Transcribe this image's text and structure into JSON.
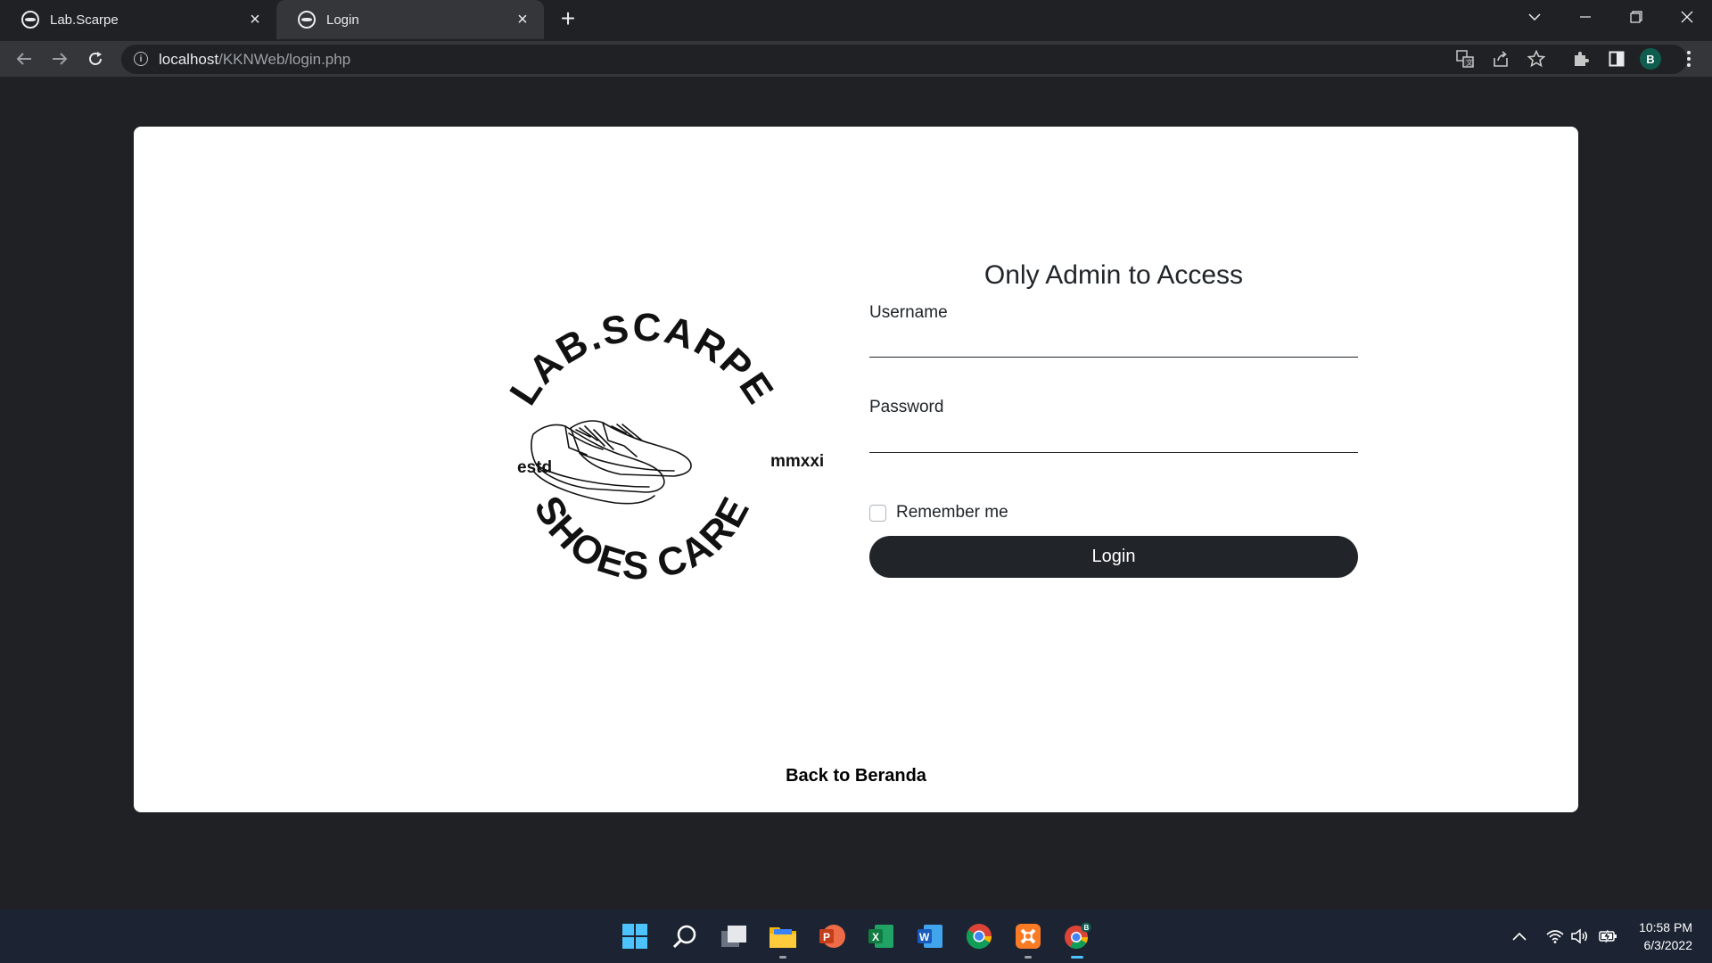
{
  "browser": {
    "tabs": [
      {
        "title": "Lab.Scarpe",
        "active": false
      },
      {
        "title": "Login",
        "active": true
      }
    ],
    "url_host": "localhost",
    "url_path": "/KKNWeb/login.php",
    "profile_initial": "B"
  },
  "logo": {
    "top_text": "LAB.SCARPE",
    "bottom_text": "SHOES CARE",
    "left_text": "estd",
    "right_text": "mmxxi"
  },
  "login": {
    "title": "Only Admin to Access",
    "username_label": "Username",
    "username_value": "",
    "password_label": "Password",
    "password_value": "",
    "remember_label": "Remember me",
    "remember_checked": false,
    "submit_label": "Login"
  },
  "footer": {
    "back_link": "Back to Beranda"
  },
  "taskbar": {
    "apps": [
      "start",
      "search",
      "task-view",
      "file-explorer",
      "powerpoint",
      "excel",
      "word",
      "chrome",
      "xampp",
      "chrome-profile"
    ],
    "time": "10:58 PM",
    "date": "6/3/2022"
  }
}
